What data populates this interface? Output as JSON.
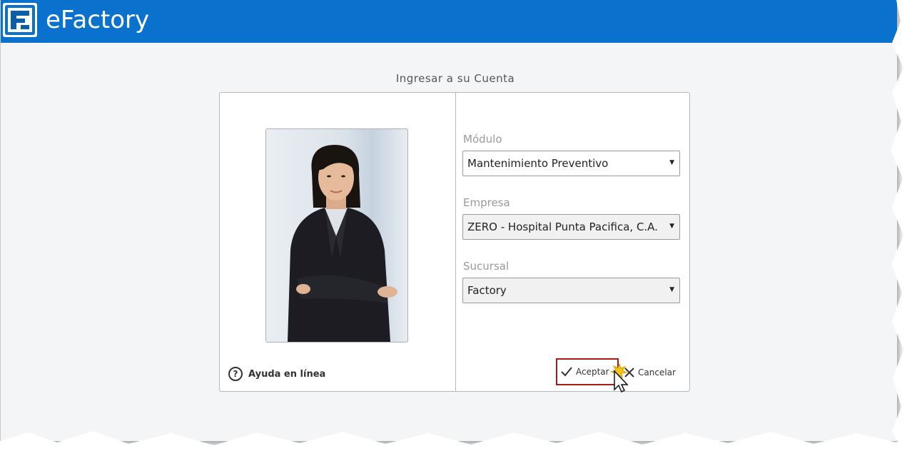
{
  "app": {
    "title": "eFactory",
    "accent_color": "#0a72cc",
    "logo_icon": "efactory-logo-icon"
  },
  "login": {
    "heading": "Ingresar a su Cuenta",
    "photo_icon": "user-photo",
    "help": {
      "icon": "help-circle-icon",
      "label": "Ayuda en línea"
    },
    "fields": {
      "modulo": {
        "label": "Módulo",
        "value": "Mantenimiento Preventivo"
      },
      "empresa": {
        "label": "Empresa",
        "value": "ZERO - Hospital Punta Pacifica, C.A."
      },
      "sucursal": {
        "label": "Sucursal",
        "value": "Factory"
      }
    },
    "buttons": {
      "accept": {
        "label": "Aceptar",
        "icon": "check-icon"
      },
      "cancel": {
        "label": "Cancelar",
        "icon": "close-icon"
      }
    }
  }
}
